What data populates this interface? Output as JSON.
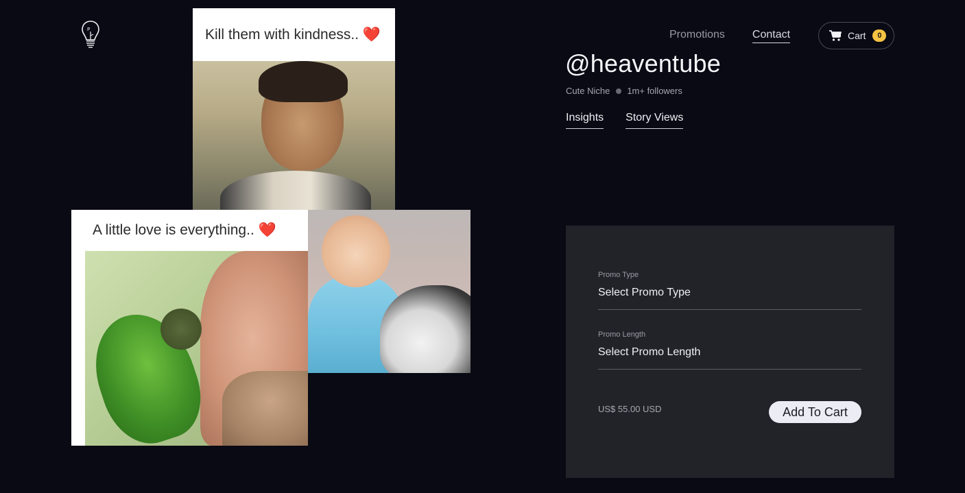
{
  "nav": {
    "items": [
      {
        "label": "Promotions",
        "active": false
      },
      {
        "label": "Contact",
        "active": true
      }
    ],
    "cart": {
      "label": "Cart",
      "count": "0"
    }
  },
  "gallery": {
    "card1_caption": "Kill them with kindness.. ❤️",
    "card2_caption": "A little love is everything.. ❤️"
  },
  "profile": {
    "handle": "@heaventube",
    "niche": "Cute Niche",
    "followers": "1m+ followers",
    "tabs": [
      {
        "label": "Insights"
      },
      {
        "label": "Story Views"
      }
    ]
  },
  "purchase": {
    "promo_type_label": "Promo Type",
    "promo_type_value": "Select Promo Type",
    "promo_length_label": "Promo Length",
    "promo_length_value": "Select Promo Length",
    "price": "US$ 55.00 USD",
    "add_button": "Add To Cart"
  },
  "colors": {
    "background": "#0a0a14",
    "panel": "#222229",
    "cart_badge": "#f5c242"
  }
}
